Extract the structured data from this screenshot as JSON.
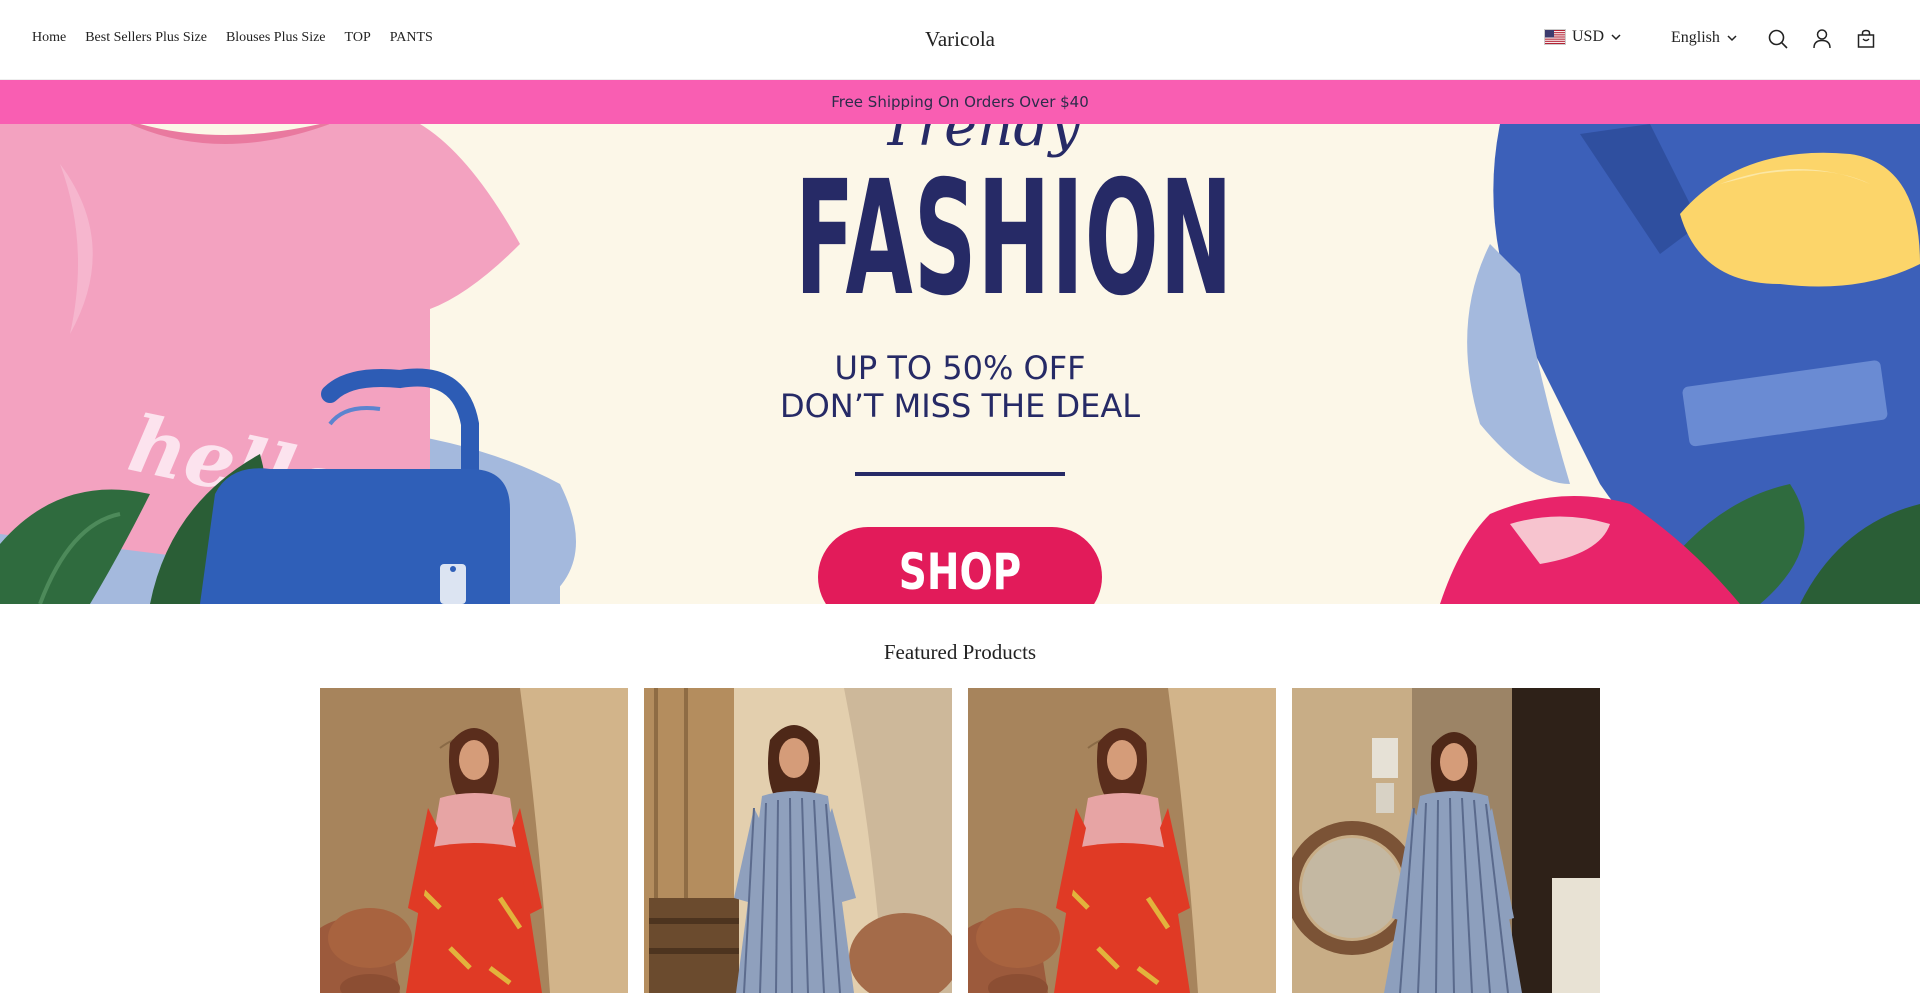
{
  "nav": {
    "items": [
      {
        "label": "Home"
      },
      {
        "label": "Best Sellers Plus Size"
      },
      {
        "label": "Blouses Plus Size"
      },
      {
        "label": "TOP"
      },
      {
        "label": "PANTS"
      }
    ]
  },
  "brand": {
    "name": "Varicola"
  },
  "currency": {
    "value": "USD",
    "flag_icon": "us-flag-icon"
  },
  "language": {
    "value": "English"
  },
  "header_icons": [
    "search-icon",
    "account-icon",
    "cart-icon"
  ],
  "announcement": {
    "text": "Free Shipping On Orders Over $40"
  },
  "hero": {
    "script_word": "Trendy",
    "headline": "FASHION",
    "sub_line_1": "UP TO 50% OFF",
    "sub_line_2": "DON’T MISS THE DEAL",
    "cta": "SHOP NOW",
    "shirt_text": "hello",
    "colors": {
      "background": "#fcf7e8",
      "headline": "#262a66",
      "cta": "#e21b5a",
      "pink": "#f48fb5",
      "blue": "#3e5fb8"
    }
  },
  "featured": {
    "title": "Featured Products",
    "products": [
      {
        "image": "woman-red-floral-dress-photo"
      },
      {
        "image": "woman-blue-striped-dress-photo"
      },
      {
        "image": "woman-red-floral-dress-photo"
      },
      {
        "image": "woman-blue-striped-long-dress-photo"
      }
    ]
  },
  "colors": {
    "announcement_bg": "#f95eb2",
    "announcement_text": "#2c2c4a"
  }
}
